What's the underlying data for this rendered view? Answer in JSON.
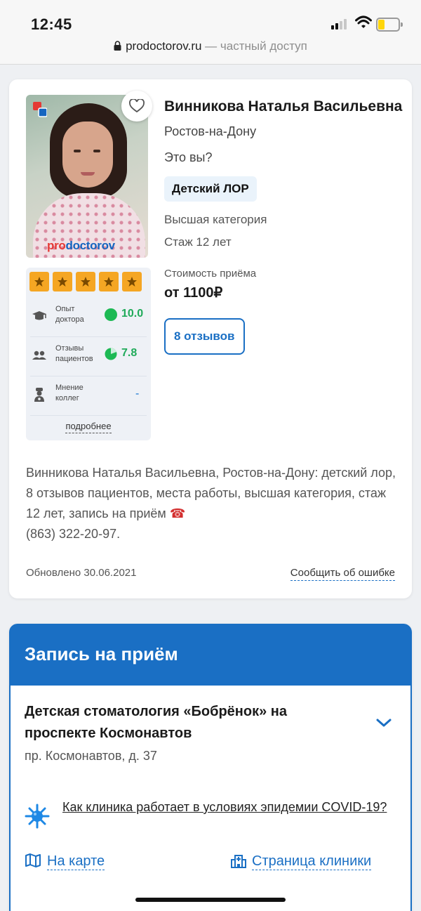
{
  "status_bar": {
    "time": "12:45"
  },
  "url_bar": {
    "domain": "prodoctorov.ru",
    "suffix": " — частный доступ"
  },
  "doctor": {
    "name": "Винникова Наталья Васильевна",
    "city": "Ростов-на-Дону",
    "claim_prompt": "Это вы?",
    "specialty": "Детский ЛОР",
    "category": "Высшая категория",
    "experience": "Стаж 12 лет",
    "price_label": "Стоимость приёма",
    "price": "от 1100₽",
    "reviews_button": "8 отзывов",
    "photo_brand": {
      "pro": "pro",
      "doctorov": "doctorov"
    }
  },
  "rating": {
    "stars": 5,
    "rows": [
      {
        "label": "Опыт доктора",
        "value": "10.0",
        "icon": "graduation-cap-icon"
      },
      {
        "label": "Отзывы пациентов",
        "value": "7.8",
        "icon": "users-icon"
      },
      {
        "label": "Мнение коллег",
        "value": "-",
        "icon": "doctor-icon"
      }
    ],
    "more_link": "подробнее"
  },
  "description": {
    "text": "Винникова Наталья Васильевна, Ростов-на-Дону: детский лор, 8 отзывов пациентов, места работы, высшая категория, стаж 12 лет, запись на приём",
    "phone": "(863) 322-20-97."
  },
  "footer": {
    "updated": "Обновлено 30.06.2021",
    "report_error": "Сообщить об ошибке"
  },
  "booking": {
    "title": "Запись на приём",
    "clinic_name": "Детская стоматология «Бобрёнок» на проспекте Космонавтов",
    "address": "пр. Космонавтов, д. 37",
    "covid_link": "Как клиника работает в условиях эпидемии COVID-19?",
    "map_link": "На карте",
    "clinic_page_link": "Страница клиники"
  },
  "colors": {
    "accent": "#1a6fc4",
    "star": "#f5a623",
    "score_green": "#1faa59"
  }
}
